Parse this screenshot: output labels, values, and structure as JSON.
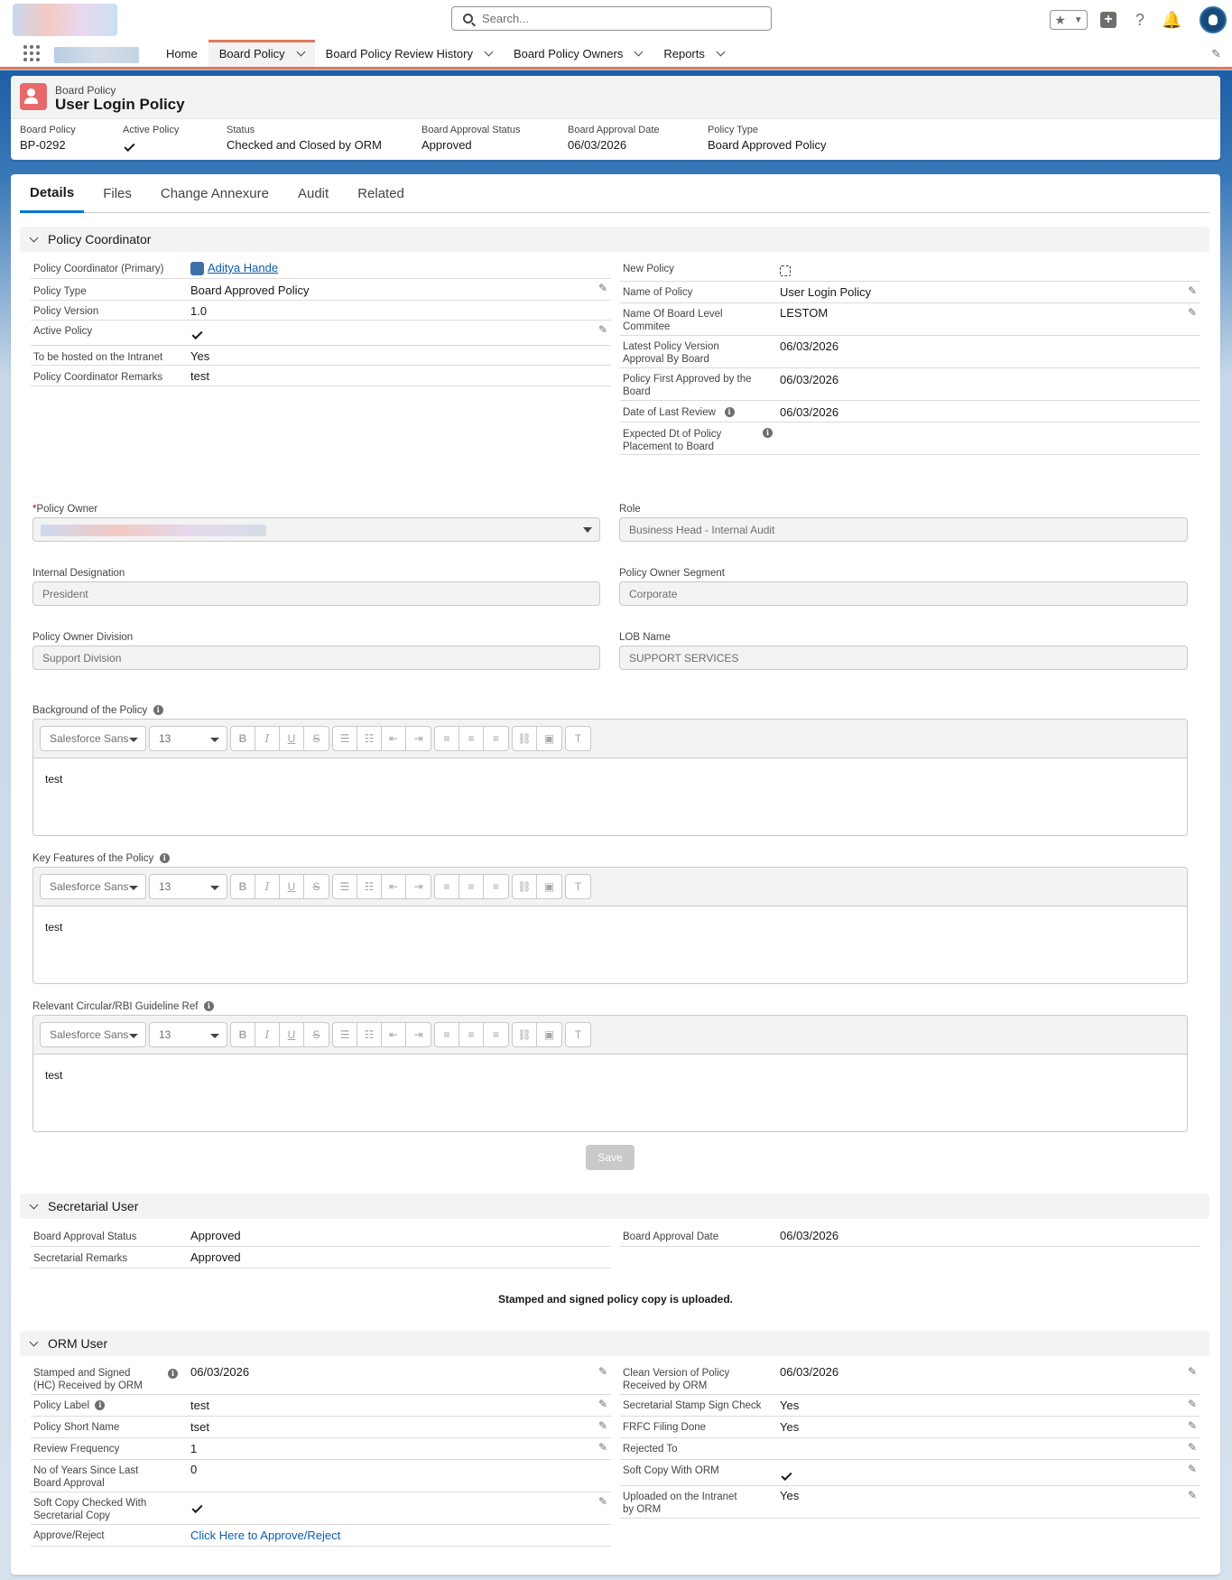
{
  "header": {
    "search_placeholder": "Search...",
    "icons": [
      "star-icon",
      "chevron-down-icon",
      "add-icon",
      "help-icon",
      "bell-icon",
      "avatar"
    ]
  },
  "nav": {
    "items": [
      {
        "label": "Home",
        "has_menu": false
      },
      {
        "label": "Board Policy",
        "has_menu": true,
        "active": true
      },
      {
        "label": "Board Policy Review History",
        "has_menu": true
      },
      {
        "label": "Board Policy Owners",
        "has_menu": true
      },
      {
        "label": "Reports",
        "has_menu": true
      }
    ]
  },
  "highlights": {
    "object": "Board Policy",
    "title": "User Login Policy",
    "fields": [
      {
        "label": "Board Policy",
        "value": "BP-0292"
      },
      {
        "label": "Active Policy",
        "value": ""
      },
      {
        "label": "Status",
        "value": "Checked and Closed by ORM"
      },
      {
        "label": "Board Approval Status",
        "value": "Approved"
      },
      {
        "label": "Board Approval Date",
        "value": "06/03/2026"
      },
      {
        "label": "Policy Type",
        "value": "Board Approved Policy"
      }
    ]
  },
  "tabs": [
    "Details",
    "Files",
    "Change Annexure",
    "Audit",
    "Related"
  ],
  "sections": {
    "coordinator": "Policy Coordinator",
    "secretarial": "Secretarial User",
    "orm": "ORM User"
  },
  "coord_left": [
    {
      "label": "Policy Coordinator (Primary)",
      "value": "Aditya Hande"
    },
    {
      "label": "Policy Type",
      "value": "Board Approved Policy"
    },
    {
      "label": "Policy Version",
      "value": "1.0"
    },
    {
      "label": "Active Policy",
      "value": ""
    },
    {
      "label": "To be hosted on the Intranet",
      "value": "Yes"
    },
    {
      "label": "Policy Coordinator Remarks",
      "value": "test"
    }
  ],
  "coord_right": [
    {
      "label": "New Policy",
      "value": ""
    },
    {
      "label": "Name of Policy",
      "value": "User Login Policy"
    },
    {
      "label": "Name Of Board Level Commitee",
      "value": "LESTOM"
    },
    {
      "label": "Latest Policy Version Approval By Board",
      "value": "06/03/2026"
    },
    {
      "label": "Policy First Approved by the Board",
      "value": "06/03/2026"
    },
    {
      "label": "Date of Last Review",
      "value": "06/03/2026"
    },
    {
      "label": "Expected Dt of Policy Placement to Board",
      "value": ""
    }
  ],
  "owner": {
    "policy_owner_label": "Policy Owner",
    "required_mark": "*",
    "role_label": "Role",
    "role_value": "Business Head - Internal Audit",
    "designation_label": "Internal Designation",
    "designation_value": "President",
    "segment_label": "Policy Owner Segment",
    "segment_value": "Corporate",
    "division_label": "Policy Owner Division",
    "division_value": "Support Division",
    "lob_label": "LOB Name",
    "lob_value": "SUPPORT SERVICES"
  },
  "rte": {
    "font": "Salesforce Sans",
    "size": "13",
    "fields": [
      {
        "label": "Background of the Policy",
        "value": "test"
      },
      {
        "label": "Key Features of the Policy",
        "value": "test"
      },
      {
        "label": "Relevant Circular/RBI Guideline Ref",
        "value": "test"
      }
    ],
    "save_label": "Save"
  },
  "secretarial_left": [
    {
      "label": "Board Approval Status",
      "value": "Approved"
    },
    {
      "label": "Secretarial Remarks",
      "value": "Approved"
    }
  ],
  "secretarial_right": [
    {
      "label": "Board Approval Date",
      "value": "06/03/2026"
    }
  ],
  "notice": "Stamped and signed policy copy is uploaded.",
  "orm_left": [
    {
      "label": "Stamped and Signed (HC) Received by ORM",
      "value": "06/03/2026"
    },
    {
      "label": "Policy Label",
      "value": "test"
    },
    {
      "label": "Policy Short Name",
      "value": "tset"
    },
    {
      "label": "Review Frequency",
      "value": "1"
    },
    {
      "label": "No of Years Since Last Board Approval",
      "value": "0"
    },
    {
      "label": "Soft Copy Checked With Secretarial Copy",
      "value": ""
    },
    {
      "label": "Approve/Reject",
      "value": "Click Here to Approve/Reject"
    }
  ],
  "orm_right": [
    {
      "label": "Clean Version of Policy Received by ORM",
      "value": "06/03/2026"
    },
    {
      "label": "Secretarial Stamp Sign Check",
      "value": "Yes"
    },
    {
      "label": "FRFC Filing Done",
      "value": "Yes"
    },
    {
      "label": "Rejected To",
      "value": ""
    },
    {
      "label": "Soft Copy With ORM",
      "value": ""
    },
    {
      "label": "Uploaded on the Intranet by ORM",
      "value": "Yes"
    }
  ],
  "colors": {
    "accent": "#0176d3",
    "nav_active": "#e07a5a",
    "object_icon": "#e8696b",
    "link": "#0b5cab"
  }
}
